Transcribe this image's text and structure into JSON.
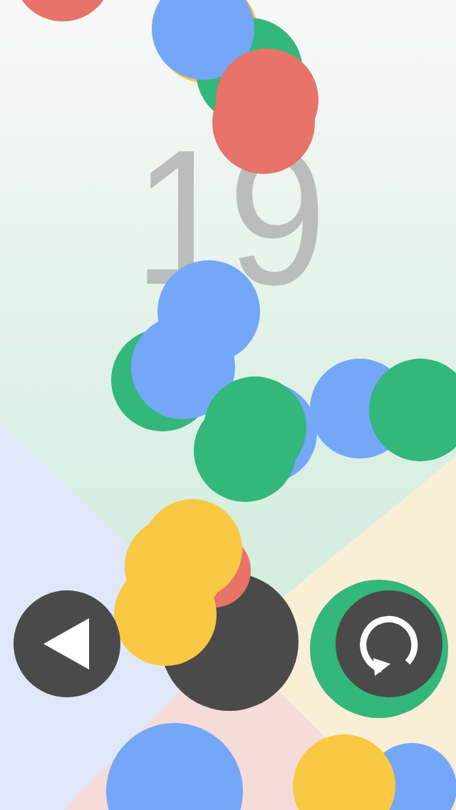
{
  "score": "19",
  "balls": [
    {
      "color": "#e87368"
    },
    {
      "color": "#f9c944"
    },
    {
      "color": "#34b77a"
    },
    {
      "color": "#74a7f8"
    },
    {
      "color": "#e87368"
    },
    {
      "color": "#e87368"
    },
    {
      "color": "#34b77a"
    },
    {
      "color": "#74a7f8"
    },
    {
      "color": "#74a7f8"
    },
    {
      "color": "#74a7f8"
    },
    {
      "color": "#34b77a"
    },
    {
      "color": "#34b77a"
    },
    {
      "color": "#74a7f8"
    },
    {
      "color": "#34b77a"
    },
    {
      "color": "#e87368"
    },
    {
      "color": "#f9c944"
    },
    {
      "color": "#f9c944"
    },
    {
      "color": "#f9c944"
    },
    {
      "color": "#34b77a"
    },
    {
      "color": "#74a7f8"
    },
    {
      "color": "#f9c944"
    },
    {
      "color": "#74a7f8"
    }
  ]
}
